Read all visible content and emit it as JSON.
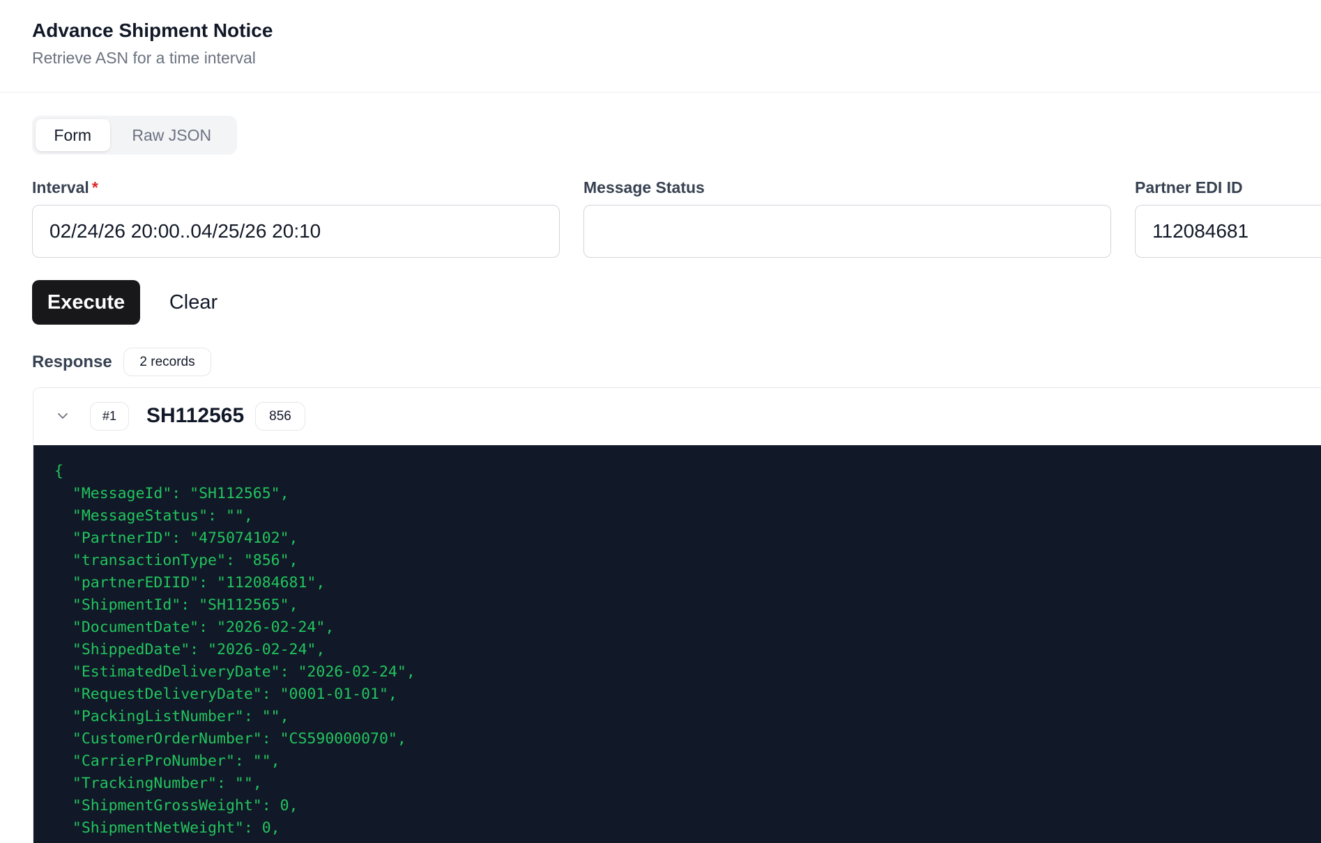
{
  "header": {
    "title": "Advance Shipment Notice",
    "subtitle": "Retrieve ASN for a time interval"
  },
  "tabs": [
    {
      "label": "Form",
      "active": true
    },
    {
      "label": "Raw JSON",
      "active": false
    }
  ],
  "form": {
    "interval": {
      "label": "Interval",
      "required_mark": "*",
      "value": "02/24/26 20:00..04/25/26 20:10"
    },
    "message_status": {
      "label": "Message Status",
      "value": ""
    },
    "partner_edi_id": {
      "label": "Partner EDI ID",
      "value": "112084681"
    }
  },
  "actions": {
    "execute_label": "Execute",
    "clear_label": "Clear"
  },
  "response": {
    "label": "Response",
    "count_badge": "2 records",
    "records": [
      {
        "index_badge": "#1",
        "id": "SH112565",
        "type_badge": "856",
        "json_lines": [
          "{",
          "  \"MessageId\": \"SH112565\",",
          "  \"MessageStatus\": \"\",",
          "  \"PartnerID\": \"475074102\",",
          "  \"transactionType\": \"856\",",
          "  \"partnerEDIID\": \"112084681\",",
          "  \"ShipmentId\": \"SH112565\",",
          "  \"DocumentDate\": \"2026-02-24\",",
          "  \"ShippedDate\": \"2026-02-24\",",
          "  \"EstimatedDeliveryDate\": \"2026-02-24\",",
          "  \"RequestDeliveryDate\": \"0001-01-01\",",
          "  \"PackingListNumber\": \"\",",
          "  \"CustomerOrderNumber\": \"CS590000070\",",
          "  \"CarrierProNumber\": \"\",",
          "  \"TrackingNumber\": \"\",",
          "  \"ShipmentGrossWeight\": 0,",
          "  \"ShipmentNetWeight\": 0,"
        ]
      }
    ]
  },
  "icons": {
    "record_toggle": "chevron-down-icon"
  },
  "colors": {
    "primary_button": "#18181b",
    "required": "#dc2626",
    "code_background": "#111827",
    "code_text": "#22c55e"
  }
}
